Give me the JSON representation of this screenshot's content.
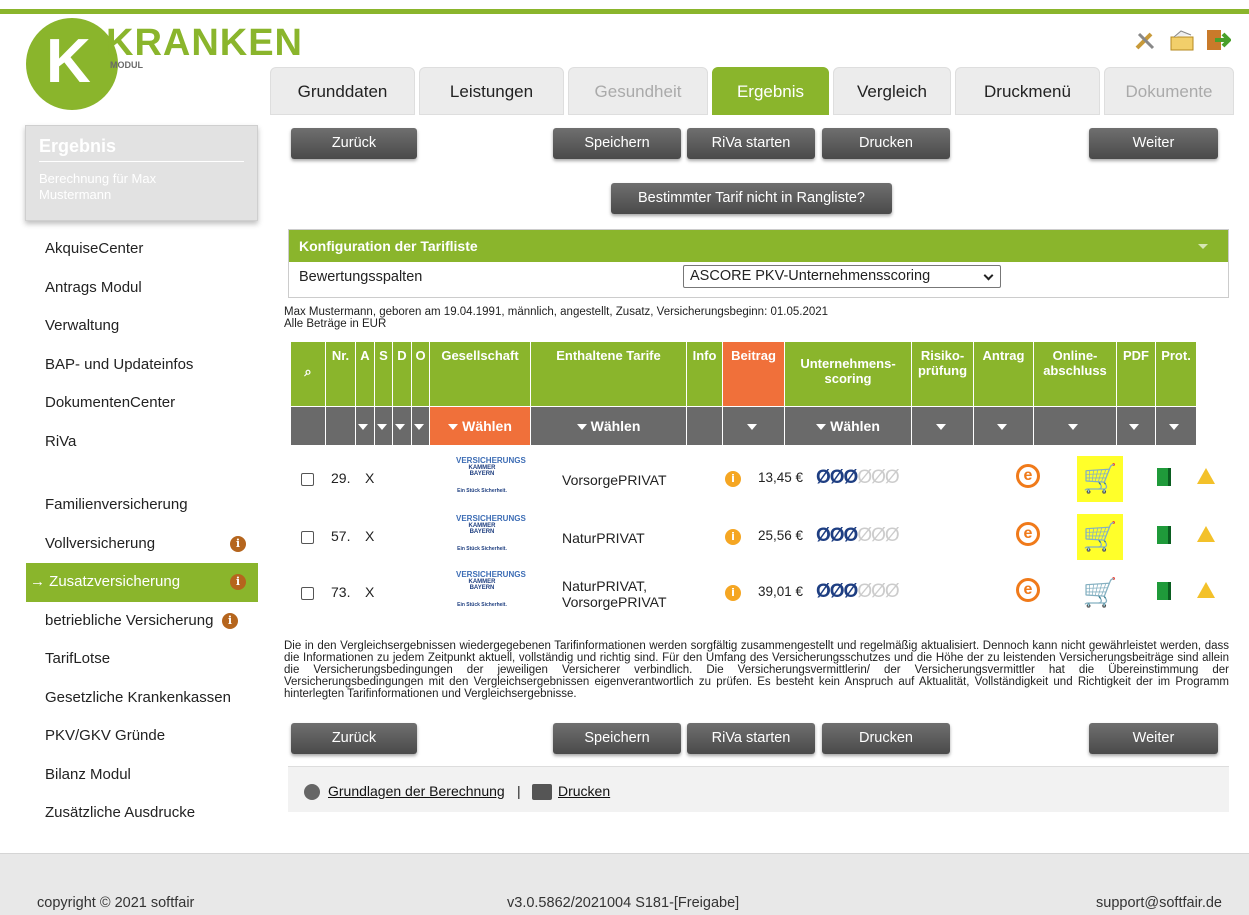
{
  "brand": {
    "logo_letter": "K",
    "logo_word": "KRANKEN",
    "logo_sub": "MODUL"
  },
  "colors": {
    "accent": "#8ab52c",
    "highlight": "#f0703a",
    "dark": "#4f4f4f"
  },
  "top_icons": [
    "tools-icon",
    "mail-folder-icon",
    "logout-icon"
  ],
  "tabs": [
    {
      "label": "Grunddaten",
      "state": "normal"
    },
    {
      "label": "Leistungen",
      "state": "normal"
    },
    {
      "label": "Gesundheit",
      "state": "disabled"
    },
    {
      "label": "Ergebnis",
      "state": "active"
    },
    {
      "label": "Vergleich",
      "state": "normal"
    },
    {
      "label": "Druckmenü",
      "state": "normal"
    },
    {
      "label": "Dokumente",
      "state": "disabled"
    }
  ],
  "sidebar": {
    "title": "Ergebnis",
    "subtitle": "Berechnung für Max Mustermann",
    "items": [
      {
        "label": "AkquiseCenter"
      },
      {
        "label": "Antrags Modul"
      },
      {
        "label": "Verwaltung"
      },
      {
        "label": "BAP- und Updateinfos"
      },
      {
        "label": "DokumentenCenter"
      },
      {
        "label": "RiVa"
      },
      {
        "label": "Familienversicherung"
      },
      {
        "label": "Vollversicherung"
      },
      {
        "label": "→ Zusatzversicherung"
      },
      {
        "label": "betriebliche Versicherung"
      },
      {
        "label": "TarifLotse"
      },
      {
        "label": "Gesetzliche Krankenkassen"
      },
      {
        "label": "PKV/GKV Gründe"
      },
      {
        "label": "Bilanz Modul"
      },
      {
        "label": "Zusätzliche Ausdrucke"
      }
    ]
  },
  "actions": {
    "back": "Zurück",
    "save": "Speichern",
    "riva": "RiVa starten",
    "print": "Drucken",
    "next": "Weiter",
    "missing_tariff": "Bestimmter Tarif nicht in Rangliste?"
  },
  "config": {
    "title": "Konfiguration der Tarifliste",
    "label": "Bewertungsspalten",
    "selected": "ASCORE PKV-Unternehmensscoring"
  },
  "meta": {
    "person": "Max Mustermann, geboren am 19.04.1991, männlich, angestellt, Zusatz, Versicherungsbeginn: 01.05.2021",
    "currency": "Alle Beträge in EUR"
  },
  "table": {
    "headers": [
      "Nr.",
      "A",
      "S",
      "D",
      "O",
      "Gesellschaft",
      "Enthaltene Tarife",
      "Info",
      "Beitrag",
      "Unternehmens-scoring",
      "Risiko-prüfung",
      "Antrag",
      "Online-abschluss",
      "PDF",
      "Prot."
    ],
    "filter_label": "Wählen",
    "rows": [
      {
        "nr": "29.",
        "a": "X",
        "insurer_l1": "VERSICHERUNGS",
        "insurer_l2": "KAMMER BAYERN",
        "insurer_l3": "Ein Stück Sicherheit.",
        "tarif": "VorsorgePRIVAT",
        "beitrag": "13,45 €",
        "score": 3,
        "cart_highlight": true
      },
      {
        "nr": "57.",
        "a": "X",
        "insurer_l1": "VERSICHERUNGS",
        "insurer_l2": "KAMMER BAYERN",
        "insurer_l3": "Ein Stück Sicherheit.",
        "tarif": "NaturPRIVAT",
        "beitrag": "25,56 €",
        "score": 3,
        "cart_highlight": true
      },
      {
        "nr": "73.",
        "a": "X",
        "insurer_l1": "VERSICHERUNGS",
        "insurer_l2": "KAMMER BAYERN",
        "insurer_l3": "Ein Stück Sicherheit.",
        "tarif": "NaturPRIVAT, VorsorgePRIVAT",
        "beitrag": "39,01 €",
        "score": 3,
        "cart_highlight": false
      }
    ]
  },
  "disclaimer": "Die in den Vergleichsergebnissen wiedergegebenen Tarifinformationen werden sorgfältig zusammengestellt und regelmäßig aktualisiert. Dennoch kann nicht gewährleistet werden, dass die Informationen zu jedem Zeitpunkt aktuell, vollständig und richtig sind. Für den Umfang des Versicherungsschutzes und die Höhe der zu leistenden Versicherungsbeiträge sind allein die Versicherungsbedingungen der jeweiligen Versicherer verbindlich. Die Versicherungsvermittlerin/ der Versicherungsvermittler hat die Übereinstimmung der Versicherungsbedingungen mit den Vergleichsergebnissen eigenverantwortlich zu prüfen. Es besteht kein Anspruch auf Aktualität, Vollständigkeit und Richtigkeit der im Programm hinterlegten Tarifinformationen und Vergleichsergebnisse.",
  "links": {
    "basis": "Grundlagen der Berechnung",
    "separator": "|",
    "print": "Drucken"
  },
  "footer": {
    "copyright": "copyright © 2021 softfair",
    "version": "v3.0.5862/2021004 S181-[Freigabe]",
    "support": "support@softfair.de"
  }
}
